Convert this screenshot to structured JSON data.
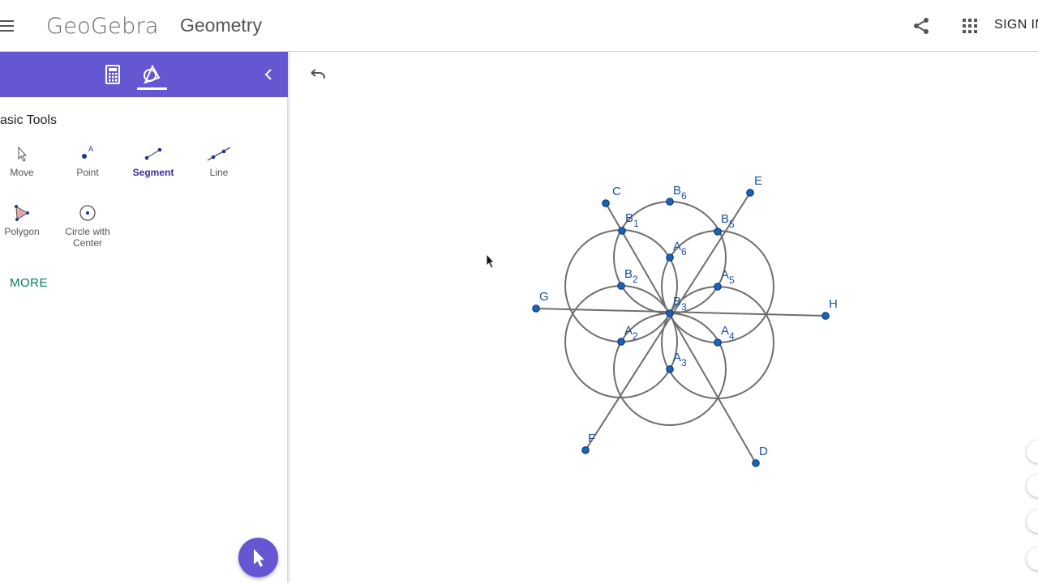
{
  "header": {
    "brand": "GeoGebra",
    "app_title": "Geometry",
    "sign_in": "SIGN IN",
    "icons": {
      "menu": "hamburger-menu-icon",
      "share": "share-icon",
      "apps": "apps-grid-icon"
    }
  },
  "panel": {
    "tabs": [
      {
        "name": "calculator-tab",
        "icon": "calculator-icon"
      },
      {
        "name": "tools-tab",
        "icon": "geometry-tools-icon",
        "selected": true
      }
    ],
    "section_title": "asic Tools",
    "tools": [
      {
        "label": "Move",
        "icon": "move-arrow-icon"
      },
      {
        "label": "Point",
        "icon": "point-icon"
      },
      {
        "label": "Segment",
        "icon": "segment-icon",
        "selected": true
      },
      {
        "label": "Line",
        "icon": "line-icon"
      },
      {
        "label": "Polygon",
        "icon": "polygon-icon"
      },
      {
        "label": "Circle with Center",
        "icon": "circle-with-center-icon"
      }
    ],
    "more": "MORE"
  },
  "colors": {
    "accent": "#6557d2",
    "point": "#1565c0",
    "label": "#1a50a0",
    "construction": "#6e6e6e",
    "more": "#00805a"
  },
  "canvas": {
    "points": [
      {
        "id": "C",
        "label": "C"
      },
      {
        "id": "B6",
        "label": "B",
        "sub": "6"
      },
      {
        "id": "E",
        "label": "E"
      },
      {
        "id": "B1",
        "label": "B",
        "sub": "1"
      },
      {
        "id": "B5",
        "label": "B",
        "sub": "5"
      },
      {
        "id": "A6",
        "label": "A",
        "sub": "6"
      },
      {
        "id": "B2",
        "label": "B",
        "sub": "2"
      },
      {
        "id": "A5",
        "label": "A",
        "sub": "5"
      },
      {
        "id": "G",
        "label": "G"
      },
      {
        "id": "B3",
        "label": "B",
        "sub": "3"
      },
      {
        "id": "H",
        "label": "H"
      },
      {
        "id": "A2",
        "label": "A",
        "sub": "2"
      },
      {
        "id": "A4",
        "label": "A",
        "sub": "4"
      },
      {
        "id": "A3",
        "label": "A",
        "sub": "3"
      },
      {
        "id": "F",
        "label": "F"
      },
      {
        "id": "D",
        "label": "D"
      }
    ]
  }
}
